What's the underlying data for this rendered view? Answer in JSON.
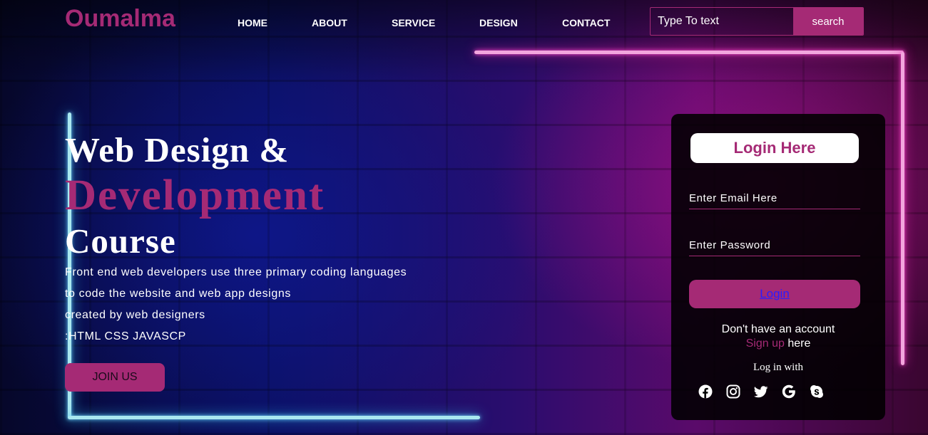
{
  "header": {
    "logo": "Oumalma",
    "nav": [
      {
        "label": "HOME"
      },
      {
        "label": "ABOUT"
      },
      {
        "label": "SERVICE"
      },
      {
        "label": "DESIGN"
      },
      {
        "label": "CONTACT"
      }
    ],
    "search": {
      "placeholder": "Type To text",
      "button_label": "search"
    }
  },
  "hero": {
    "title_line1": "Web Design &",
    "title_line2": "Development",
    "title_line3": "Course",
    "description": [
      "Front end web developers use three primary coding languages",
      "to code the website and web app designs",
      "created by web designers",
      ":HTML CSS JAVASCP"
    ],
    "cta_label": "JOIN US"
  },
  "login": {
    "title": "Login Here",
    "email_placeholder": "Enter Email Here",
    "password_placeholder": "Enter Password",
    "button_label": "Login",
    "no_account": "Don't have an account",
    "signup_link": "Sign up",
    "signup_suffix": " here",
    "login_with": "Log in with",
    "social_icons": [
      "facebook-icon",
      "instagram-icon",
      "twitter-icon",
      "google-icon",
      "skype-icon"
    ]
  },
  "colors": {
    "accent": "#a52a75",
    "text": "#ffffff",
    "card": "#000000",
    "link": "#2a1cff"
  }
}
